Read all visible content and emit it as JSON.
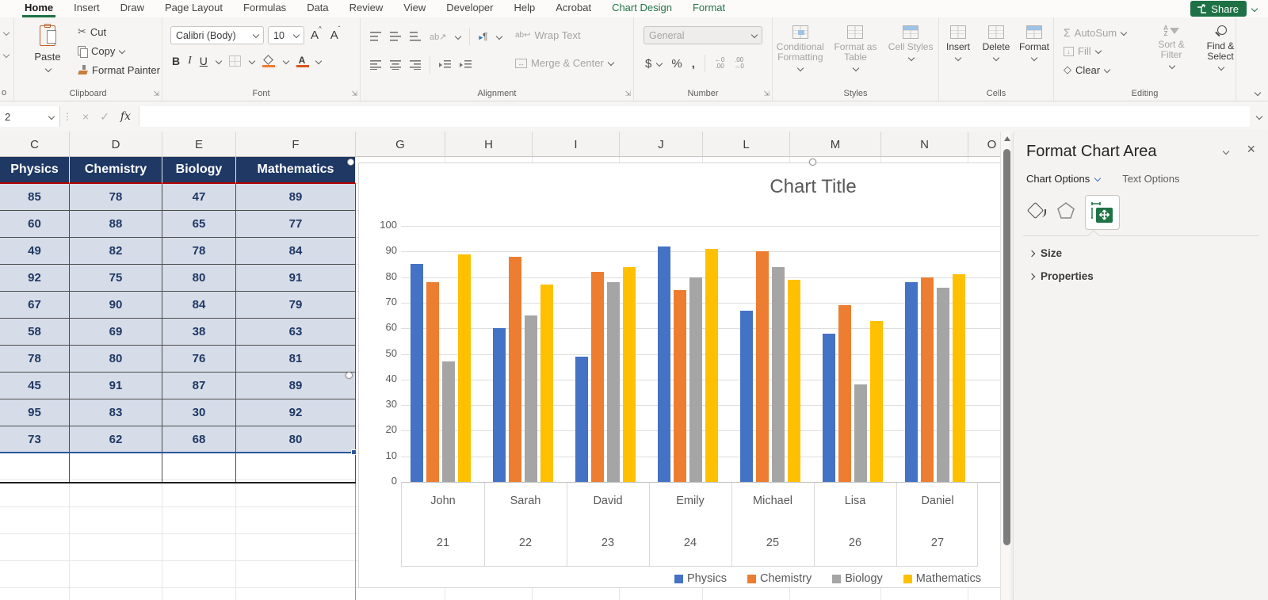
{
  "ribbon": {
    "tabs": [
      {
        "label": "Home",
        "state": "active"
      },
      {
        "label": "Insert",
        "state": "normal"
      },
      {
        "label": "Draw",
        "state": "normal"
      },
      {
        "label": "Page Layout",
        "state": "normal"
      },
      {
        "label": "Formulas",
        "state": "normal"
      },
      {
        "label": "Data",
        "state": "normal"
      },
      {
        "label": "Review",
        "state": "normal"
      },
      {
        "label": "View",
        "state": "normal"
      },
      {
        "label": "Developer",
        "state": "normal"
      },
      {
        "label": "Help",
        "state": "normal"
      },
      {
        "label": "Acrobat",
        "state": "normal"
      },
      {
        "label": "Chart Design",
        "state": "contextual"
      },
      {
        "label": "Format",
        "state": "contextual"
      }
    ],
    "share_label": "Share",
    "clipboard": {
      "label": "Clipboard",
      "paste": "Paste",
      "cut": "Cut",
      "copy": "Copy",
      "format_painter": "Format Painter"
    },
    "font": {
      "label": "Font",
      "name": "Calibri (Body)",
      "size": "10",
      "bold": "B",
      "italic": "I",
      "underline": "U"
    },
    "alignment": {
      "label": "Alignment",
      "wrap": "Wrap Text",
      "merge": "Merge & Center",
      "pilcrow": "¶",
      "ab": "ab"
    },
    "number": {
      "label": "Number",
      "format": "General",
      "currency": "$",
      "percent": "%",
      "comma": ",",
      "inc_dec": "←0 .00",
      "dec_dec": ".00 →0"
    },
    "styles": {
      "label": "Styles",
      "conditional": "Conditional Formatting",
      "table": "Format as Table",
      "cell": "Cell Styles"
    },
    "cells": {
      "label": "Cells",
      "insert": "Insert",
      "delete": "Delete",
      "format": "Format"
    },
    "editing": {
      "label": "Editing",
      "autosum": "AutoSum",
      "fill": "Fill",
      "clear": "Clear",
      "sort": "Sort & Filter",
      "find": "Find & Select"
    }
  },
  "formula_bar": {
    "name_box": "2",
    "fx": "fx"
  },
  "sheet": {
    "columns": [
      "C",
      "D",
      "E",
      "F",
      "G",
      "H",
      "I",
      "J",
      "L",
      "M",
      "N",
      "O"
    ],
    "table": {
      "headers": [
        "Physics",
        "Chemistry",
        "Biology",
        "Mathematics"
      ],
      "rows": [
        [
          85,
          78,
          47,
          89
        ],
        [
          60,
          88,
          65,
          77
        ],
        [
          49,
          82,
          78,
          84
        ],
        [
          92,
          75,
          80,
          91
        ],
        [
          67,
          90,
          84,
          79
        ],
        [
          58,
          69,
          38,
          63
        ],
        [
          78,
          80,
          76,
          81
        ],
        [
          45,
          91,
          87,
          89
        ],
        [
          95,
          83,
          30,
          92
        ],
        [
          73,
          62,
          68,
          80
        ]
      ]
    },
    "colors": {
      "table_header_bg": "#1f3864",
      "table_header_text": "#ffffff",
      "table_header_border": "#b00000",
      "table_row_bg": "#d6dce8",
      "table_row_text": "#1f3864",
      "selection": "#2b579a"
    }
  },
  "chart_data": {
    "type": "bar",
    "title": "Chart Title",
    "categories": [
      "John",
      "Sarah",
      "David",
      "Emily",
      "Michael",
      "Lisa",
      "Daniel"
    ],
    "category_sub": [
      "21",
      "22",
      "23",
      "24",
      "25",
      "26",
      "27"
    ],
    "series": [
      {
        "name": "Physics",
        "color": "#4472c4",
        "values": [
          85,
          60,
          49,
          92,
          67,
          58,
          78
        ]
      },
      {
        "name": "Chemistry",
        "color": "#ed7d31",
        "values": [
          78,
          88,
          82,
          75,
          90,
          69,
          80
        ]
      },
      {
        "name": "Biology",
        "color": "#a5a5a5",
        "values": [
          47,
          65,
          78,
          80,
          84,
          38,
          76
        ]
      },
      {
        "name": "Mathematics",
        "color": "#ffc000",
        "values": [
          89,
          77,
          84,
          91,
          79,
          63,
          81
        ]
      }
    ],
    "ylim": [
      0,
      100
    ],
    "ytick_step": 10,
    "grid": true,
    "legend_position": "bottom",
    "xlabel": "",
    "ylabel": ""
  },
  "panel": {
    "title": "Format Chart Area",
    "tab_chart_options": "Chart Options",
    "tab_text_options": "Text Options",
    "sections": [
      "Size",
      "Properties"
    ]
  },
  "icons": {
    "cut": "✂",
    "autosum": "Σ",
    "clear": "◇",
    "menu_dots": "⋮",
    "cancel": "×",
    "confirm": "✓",
    "close": "×",
    "merge_arrows": "↔",
    "fill_down_arrow": "↓"
  }
}
